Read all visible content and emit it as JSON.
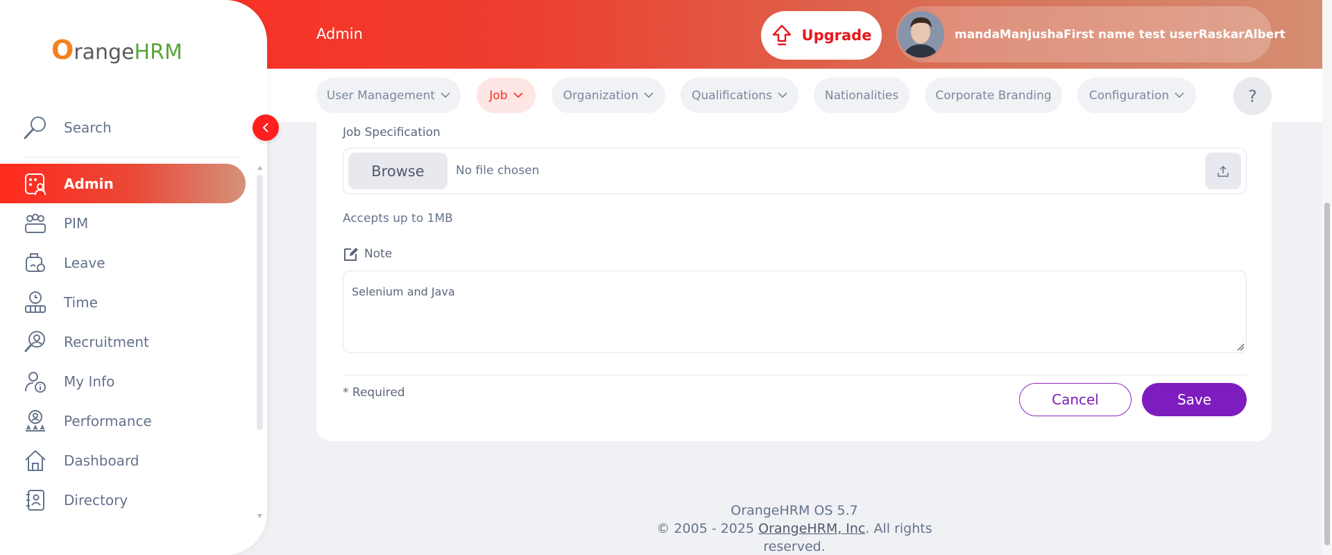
{
  "header": {
    "title": "Admin",
    "upgrade_label": "Upgrade",
    "user_name": "mandaManjushaFirst name test userRaskarAlbert"
  },
  "subnav": {
    "items": [
      {
        "label": "User Management"
      },
      {
        "label": "Job"
      },
      {
        "label": "Organization"
      },
      {
        "label": "Qualifications"
      },
      {
        "label": "Nationalities"
      },
      {
        "label": "Corporate Branding"
      },
      {
        "label": "Configuration"
      }
    ],
    "help_label": "?"
  },
  "form": {
    "job_spec_label": "Job Specification",
    "browse_label": "Browse",
    "file_status": "No file chosen",
    "hint": "Accepts up to 1MB",
    "note_label": "Note",
    "note_value": "Selenium and Java",
    "required_text": "* Required",
    "cancel_label": "Cancel",
    "save_label": "Save"
  },
  "footer": {
    "version": "OrangeHRM OS 5.7",
    "copyright_prefix": "© 2005 - 2025 ",
    "company_link": "OrangeHRM, Inc",
    "copyright_suffix": ". All rights reserved."
  },
  "sidebar": {
    "logo": {
      "o": "O",
      "range": "range",
      "hrm": "HRM"
    },
    "search_label": "Search",
    "items": [
      {
        "label": "Admin",
        "icon": "admin-icon"
      },
      {
        "label": "PIM",
        "icon": "pim-icon"
      },
      {
        "label": "Leave",
        "icon": "leave-icon"
      },
      {
        "label": "Time",
        "icon": "time-icon"
      },
      {
        "label": "Recruitment",
        "icon": "recruitment-icon"
      },
      {
        "label": "My Info",
        "icon": "my-info-icon"
      },
      {
        "label": "Performance",
        "icon": "performance-icon"
      },
      {
        "label": "Dashboard",
        "icon": "dashboard-icon"
      },
      {
        "label": "Directory",
        "icon": "directory-icon"
      }
    ]
  },
  "colors": {
    "brand_orange": "#ff2a1e",
    "accent_purple": "#7d1cbf",
    "text_muted": "#64728c"
  }
}
